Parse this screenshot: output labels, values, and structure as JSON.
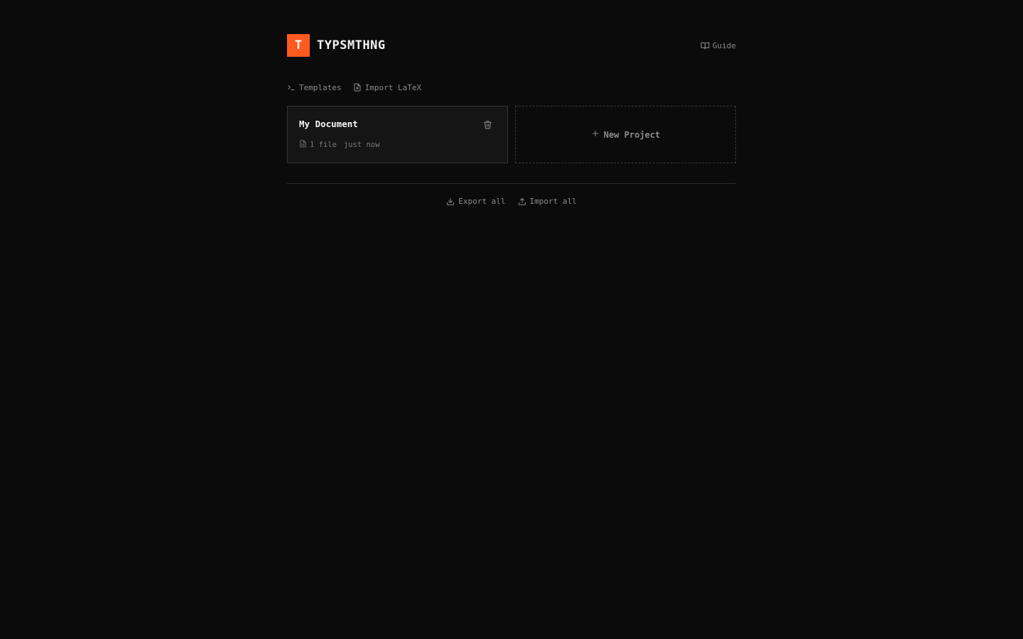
{
  "brand": {
    "logo_letter": "T",
    "name": "TYPSMTHNG",
    "accent_color": "#ff5a1f"
  },
  "header": {
    "guide_label": "Guide",
    "guide_icon": "book-open-icon"
  },
  "actions": {
    "templates_label": "Templates",
    "templates_icon": "terminal-icon",
    "import_latex_label": "Import LaTeX",
    "import_latex_icon": "file-import-icon"
  },
  "projects": [
    {
      "title": "My Document",
      "file_count": "1 file",
      "updated": "just now",
      "file_icon": "file-icon",
      "delete_icon": "trash-icon"
    }
  ],
  "new_project": {
    "label": "New Project",
    "icon": "plus-icon"
  },
  "footer": {
    "export_label": "Export all",
    "export_icon": "download-icon",
    "import_label": "Import all",
    "import_icon": "upload-icon"
  }
}
